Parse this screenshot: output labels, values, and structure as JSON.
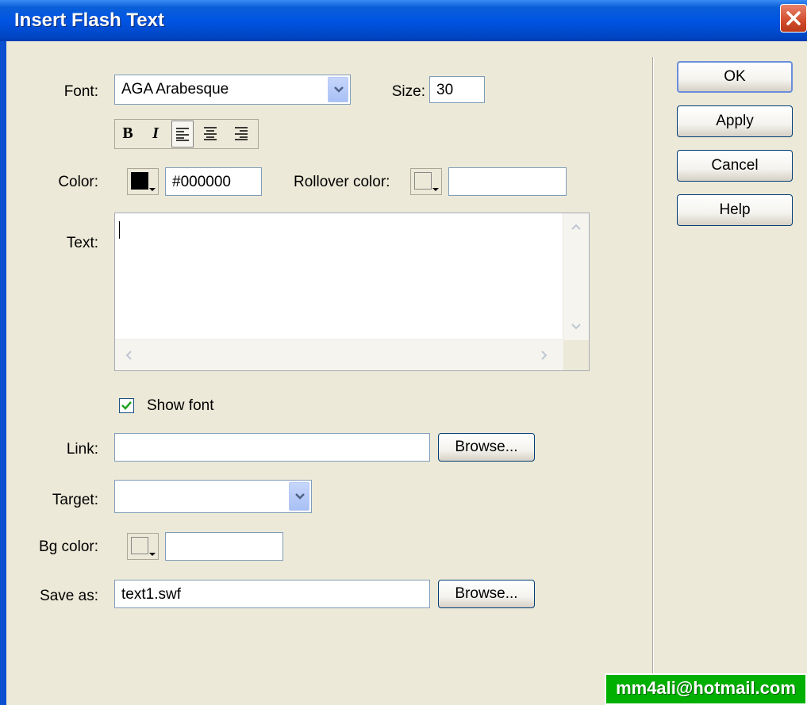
{
  "window": {
    "title": "Insert Flash Text",
    "title_bar_color": "#0054e3",
    "close_icon": "close-icon"
  },
  "font_row": {
    "font_label": "Font:",
    "font_value": "AGA Arabesque",
    "size_label": "Size:",
    "size_value": "30"
  },
  "format_buttons": [
    {
      "name": "bold",
      "glyph": "B"
    },
    {
      "name": "italic",
      "glyph": "I"
    },
    {
      "name": "align-left",
      "icon": "align-left-icon"
    },
    {
      "name": "align-center",
      "icon": "align-center-icon"
    },
    {
      "name": "align-right",
      "icon": "align-right-icon"
    }
  ],
  "color_row": {
    "color_label": "Color:",
    "color_swatch": "#000000",
    "color_value": "#000000",
    "rollover_label": "Rollover color:",
    "rollover_value": ""
  },
  "text_area": {
    "label": "Text:",
    "value": ""
  },
  "show_font": {
    "label": "Show font",
    "checked": true
  },
  "link": {
    "label": "Link:",
    "value": "",
    "browse_label": "Browse..."
  },
  "target": {
    "label": "Target:",
    "value": ""
  },
  "bg_color": {
    "label": "Bg color:",
    "value": ""
  },
  "save_as": {
    "label": "Save as:",
    "value": "text1.swf",
    "browse_label": "Browse..."
  },
  "buttons": {
    "ok": "OK",
    "apply": "Apply",
    "cancel": "Cancel",
    "help": "Help"
  },
  "watermark": "mm4ali@hotmail.com"
}
